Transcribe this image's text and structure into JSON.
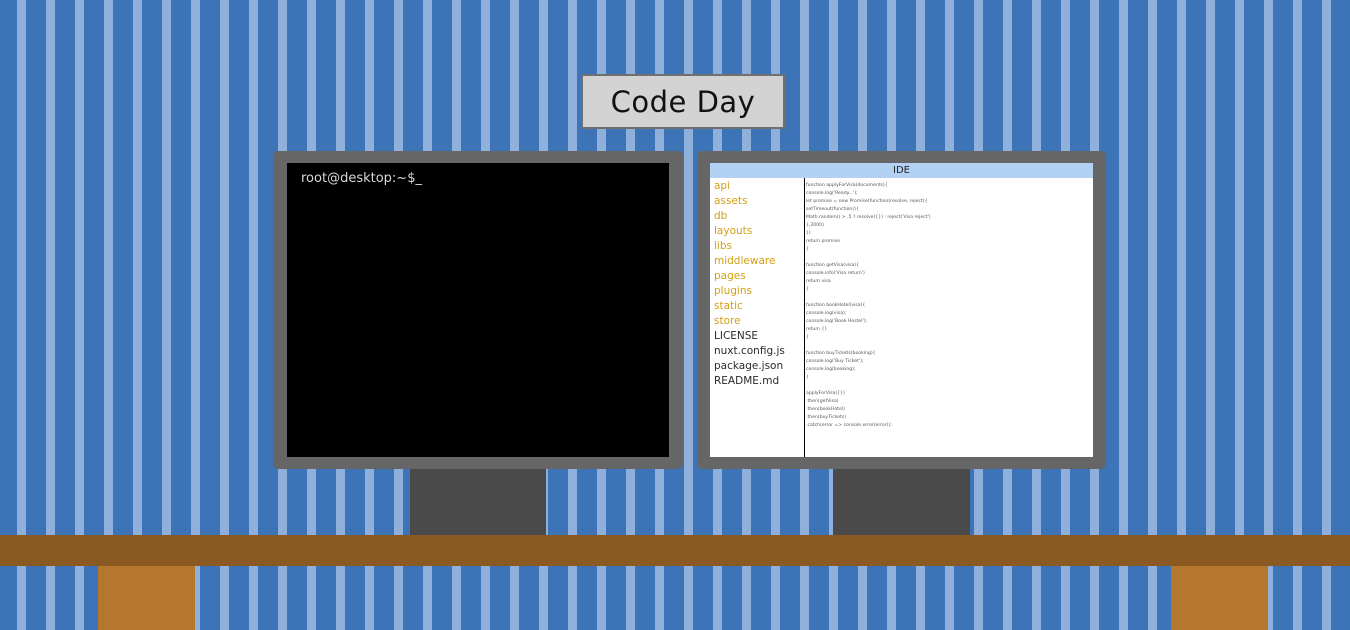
{
  "sign": {
    "title": "Code Day"
  },
  "terminal": {
    "prompt": "root@desktop:~$_"
  },
  "ide": {
    "title": "IDE",
    "folders": [
      "api",
      "assets",
      "db",
      "layouts",
      "libs",
      "middleware",
      "pages",
      "plugins",
      "static",
      "store"
    ],
    "files": [
      "LICENSE",
      "nuxt.config.js",
      "package.json",
      "README.md"
    ],
    "code": "function applyForVisa(documents){\nconsole.log('Ready...');\nlet promise = new Promise(function(resolve, reject){\nsetTimeout(function(){\nMath.random() > .5 ? resolve({}) : reject('Visa reject')\n},2000)\n})\nreturn promise\n}\n\nfunction getVisa(visa){\nconsole.info('Visa return')\nreturn visa\n}\n\nfunction bookHotel(visa){\nconsole.log(visa);\nconsole.log('Book Hostel');\nreturn {}\n}\n\nfunction buyTickets(booking){\nconsole.log('Buy Ticket');\nconsole.log(booking);\n}\n\napplyForVisa({})\n.then(getVisa)\n.then(bookHotel)\n.then(buyTickets)\n.catch(error => console.error(error));"
  },
  "colors": {
    "wall": "#3d74b8",
    "wall_stripe": "#8fb0da",
    "monitor_frame": "#666666",
    "desk": "#8b5a23",
    "desk_leg": "#b5772e",
    "ide_header": "#b3d1f3",
    "folder": "#d1a012"
  }
}
